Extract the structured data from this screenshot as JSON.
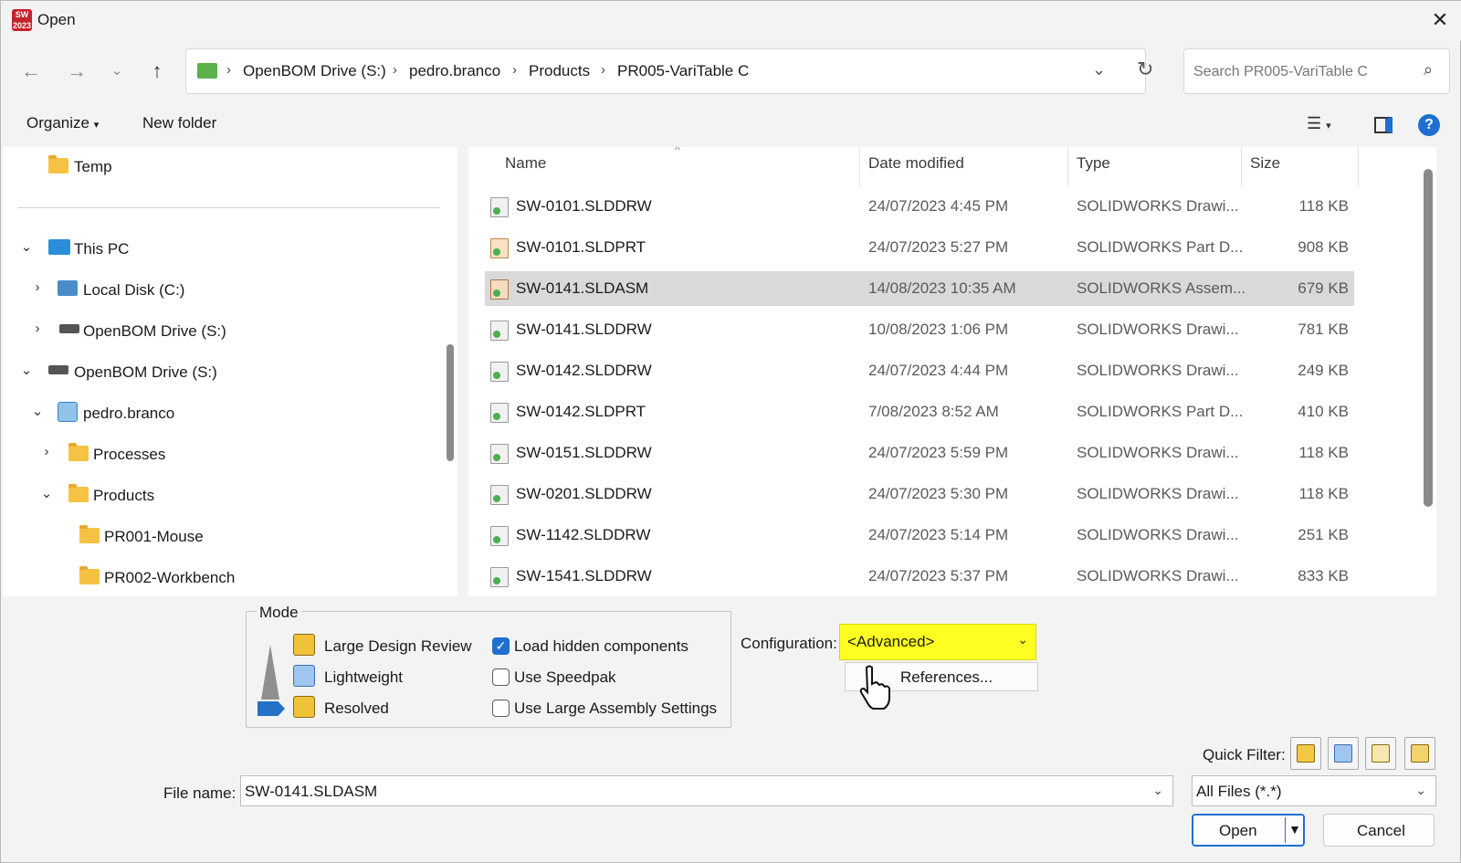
{
  "window": {
    "title": "Open",
    "app_badge": "SW 2023"
  },
  "nav": {
    "back_icon": "arrow-left-icon",
    "forward_icon": "arrow-right-icon",
    "recent_icon": "chevron-down-icon",
    "up_icon": "arrow-up-icon",
    "breadcrumb": [
      "OpenBOM Drive (S:)",
      "pedro.branco",
      "Products",
      "PR005-VariTable C"
    ],
    "search_placeholder": "Search PR005-VariTable C"
  },
  "command_bar": {
    "organize": "Organize",
    "new_folder": "New folder"
  },
  "tree": {
    "items": [
      {
        "label": "Temp"
      },
      {
        "label": "This PC"
      },
      {
        "label": "Local Disk (C:)"
      },
      {
        "label": "OpenBOM Drive (S:)"
      },
      {
        "label": "OpenBOM Drive (S:)"
      },
      {
        "label": "pedro.branco"
      },
      {
        "label": "Processes"
      },
      {
        "label": "Products"
      },
      {
        "label": "PR001-Mouse"
      },
      {
        "label": "PR002-Workbench"
      }
    ]
  },
  "files": {
    "columns": [
      "Name",
      "Date modified",
      "Type",
      "Size"
    ],
    "rows": [
      {
        "name": "SW-0101.SLDDRW",
        "date": "24/07/2023 4:45 PM",
        "type": "SOLIDWORKS Drawi...",
        "size": "118 KB"
      },
      {
        "name": "SW-0101.SLDPRT",
        "date": "24/07/2023 5:27 PM",
        "type": "SOLIDWORKS Part D...",
        "size": "908 KB"
      },
      {
        "name": "SW-0141.SLDASM",
        "date": "14/08/2023 10:35 AM",
        "type": "SOLIDWORKS Assem...",
        "size": "679 KB"
      },
      {
        "name": "SW-0141.SLDDRW",
        "date": "10/08/2023 1:06 PM",
        "type": "SOLIDWORKS Drawi...",
        "size": "781 KB"
      },
      {
        "name": "SW-0142.SLDDRW",
        "date": "24/07/2023 4:44 PM",
        "type": "SOLIDWORKS Drawi...",
        "size": "249 KB"
      },
      {
        "name": "SW-0142.SLDPRT",
        "date": "7/08/2023 8:52 AM",
        "type": "SOLIDWORKS Part D...",
        "size": "410 KB"
      },
      {
        "name": "SW-0151.SLDDRW",
        "date": "24/07/2023 5:59 PM",
        "type": "SOLIDWORKS Drawi...",
        "size": "118 KB"
      },
      {
        "name": "SW-0201.SLDDRW",
        "date": "24/07/2023 5:30 PM",
        "type": "SOLIDWORKS Drawi...",
        "size": "118 KB"
      },
      {
        "name": "SW-1142.SLDDRW",
        "date": "24/07/2023 5:14 PM",
        "type": "SOLIDWORKS Drawi...",
        "size": "251 KB"
      },
      {
        "name": "SW-1541.SLDDRW",
        "date": "24/07/2023 5:37 PM",
        "type": "SOLIDWORKS Drawi...",
        "size": "833 KB"
      }
    ]
  },
  "mode": {
    "title": "Mode",
    "options": [
      "Large Design Review",
      "Lightweight",
      "Resolved"
    ],
    "checks": [
      {
        "label": "Load hidden components",
        "checked": true
      },
      {
        "label": "Use Speedpak",
        "checked": false
      },
      {
        "label": "Use Large Assembly Settings",
        "checked": false
      }
    ]
  },
  "configuration": {
    "label": "Configuration:",
    "value": "<Advanced>",
    "references": "References...",
    "highlight": "#ffff21"
  },
  "quick_filter": {
    "label": "Quick Filter:"
  },
  "file_name": {
    "label": "File name:",
    "value": "SW-0141.SLDASM"
  },
  "file_type": {
    "value": "All Files (*.*)"
  },
  "buttons": {
    "open": "Open",
    "cancel": "Cancel"
  },
  "colors": {
    "accent": "#1f6fd0",
    "selection": "#d9d9d9"
  }
}
